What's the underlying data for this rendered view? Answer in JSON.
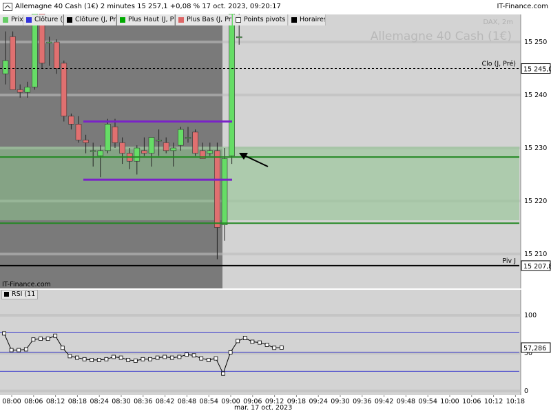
{
  "header": {
    "title": "Allemagne 40 Cash (1€) 2 minutes 15 257,1 +0,08 % 17 oct. 2023, 09:20:17",
    "brand": "IT-Finance.com"
  },
  "legend": [
    {
      "label": "Prix",
      "color": "#66cc66"
    },
    {
      "label": "Clôture (J",
      "color": "#3333dd"
    },
    {
      "label": "Clôture (J, Pré",
      "color": "#000000"
    },
    {
      "label": "Plus Haut (J, Pr",
      "color": "#00aa00"
    },
    {
      "label": "Plus Bas (J, Pr",
      "color": "#dd6666"
    },
    {
      "label": "Points pivots (",
      "color": "#ffffff"
    },
    {
      "label": "Horaires",
      "color": "#000000"
    }
  ],
  "watermark": {
    "line1": "DAX, 2m",
    "line2": "Allemagne 40 Cash (1€)"
  },
  "colors": {
    "up": "#66dd66",
    "down": "#e07070",
    "resistance": "#228822",
    "support_band": "#9cc59c",
    "range_lines": "#7a22c8",
    "pre_session": "#7a7a7a",
    "background": "#d3d3d3"
  },
  "chart_data": [
    {
      "type": "candlestick",
      "title": "Allemagne 40 Cash (1€)",
      "interval": "2 minutes",
      "x_tick_labels": [
        "08:00",
        "08:06",
        "08:12",
        "08:18",
        "08:24",
        "08:30",
        "08:36",
        "08:42",
        "08:48",
        "08:54",
        "09:00",
        "09:06",
        "09:12",
        "09:18",
        "09:24",
        "09:30",
        "09:36",
        "09:42",
        "09:48",
        "09:54",
        "10:00",
        "10:06",
        "10:12",
        "10:18"
      ],
      "date_label": "mar. 17 oct. 2023",
      "y_tick_labels": [
        "15 250",
        "15 240",
        "15 230",
        "15 220",
        "15 210"
      ],
      "ylim": [
        15203.5,
        15255.2
      ],
      "candles": [
        {
          "t": "08:00",
          "o": 15244.0,
          "h": 15252.0,
          "l": 15242.0,
          "c": 15246.5
        },
        {
          "t": "08:02",
          "o": 15251.0,
          "h": 15252.0,
          "l": 15241.0,
          "c": 15241.0
        },
        {
          "t": "08:04",
          "o": 15241.0,
          "h": 15242.0,
          "l": 15239.5,
          "c": 15240.5
        },
        {
          "t": "08:06",
          "o": 15240.5,
          "h": 15242.5,
          "l": 15239.5,
          "c": 15241.5
        },
        {
          "t": "08:08",
          "o": 15241.5,
          "h": 15256.0,
          "l": 15241.0,
          "c": 15256.0
        },
        {
          "t": "08:10",
          "o": 15256.0,
          "h": 15256.0,
          "l": 15245.0,
          "c": 15246.0
        },
        {
          "t": "08:12",
          "o": 15250.0,
          "h": 15251.0,
          "l": 15245.5,
          "c": 15250.0
        },
        {
          "t": "08:14",
          "o": 15250.0,
          "h": 15250.5,
          "l": 15244.0,
          "c": 15245.0
        },
        {
          "t": "08:16",
          "o": 15246.0,
          "h": 15246.5,
          "l": 15235.0,
          "c": 15236.0
        },
        {
          "t": "08:18",
          "o": 15236.0,
          "h": 15236.5,
          "l": 15233.5,
          "c": 15234.5
        },
        {
          "t": "08:20",
          "o": 15234.5,
          "h": 15236.0,
          "l": 15231.0,
          "c": 15231.5
        },
        {
          "t": "08:22",
          "o": 15231.5,
          "h": 15232.5,
          "l": 15229.0,
          "c": 15231.0
        },
        {
          "t": "08:24",
          "o": 15229.5,
          "h": 15231.0,
          "l": 15226.5,
          "c": 15229.5
        },
        {
          "t": "08:26",
          "o": 15228.5,
          "h": 15230.5,
          "l": 15224.5,
          "c": 15229.5
        },
        {
          "t": "08:28",
          "o": 15229.5,
          "h": 15235.5,
          "l": 15229.0,
          "c": 15234.5
        },
        {
          "t": "08:30",
          "o": 15234.0,
          "h": 15235.5,
          "l": 15230.0,
          "c": 15231.0
        },
        {
          "t": "08:32",
          "o": 15231.0,
          "h": 15232.0,
          "l": 15227.0,
          "c": 15229.0
        },
        {
          "t": "08:34",
          "o": 15229.0,
          "h": 15230.0,
          "l": 15226.0,
          "c": 15227.5
        },
        {
          "t": "08:36",
          "o": 15227.5,
          "h": 15230.5,
          "l": 15225.0,
          "c": 15230.0
        },
        {
          "t": "08:38",
          "o": 15229.5,
          "h": 15232.0,
          "l": 15228.5,
          "c": 15229.0
        },
        {
          "t": "08:40",
          "o": 15229.0,
          "h": 15231.5,
          "l": 15226.5,
          "c": 15232.0
        },
        {
          "t": "08:42",
          "o": 15231.5,
          "h": 15233.5,
          "l": 15228.5,
          "c": 15231.5
        },
        {
          "t": "08:44",
          "o": 15231.0,
          "h": 15232.0,
          "l": 15229.0,
          "c": 15229.5
        },
        {
          "t": "08:46",
          "o": 15229.5,
          "h": 15231.0,
          "l": 15226.5,
          "c": 15230.0
        },
        {
          "t": "08:48",
          "o": 15230.5,
          "h": 15234.0,
          "l": 15229.5,
          "c": 15233.5
        },
        {
          "t": "08:50",
          "o": 15232.0,
          "h": 15234.0,
          "l": 15231.0,
          "c": 15232.0
        },
        {
          "t": "08:52",
          "o": 15233.0,
          "h": 15233.5,
          "l": 15228.5,
          "c": 15229.0
        },
        {
          "t": "08:54",
          "o": 15229.5,
          "h": 15231.0,
          "l": 15228.0,
          "c": 15228.0
        },
        {
          "t": "08:56",
          "o": 15229.0,
          "h": 15231.0,
          "l": 15228.5,
          "c": 15229.5
        },
        {
          "t": "08:58",
          "o": 15229.5,
          "h": 15231.0,
          "l": 15209.0,
          "c": 15215.0
        },
        {
          "t": "09:00",
          "o": 15215.5,
          "h": 15230.0,
          "l": 15212.5,
          "c": 15228.0
        },
        {
          "t": "09:02",
          "o": 15228.5,
          "h": 15258.0,
          "l": 15227.0,
          "c": 15258.0
        },
        {
          "t": "09:04",
          "o": 15251.0,
          "h": 15257.5,
          "l": 15249.5,
          "c": 15251.0
        }
      ],
      "levels": [
        {
          "name": "Clo (J, Pré)",
          "value": "15 245,0"
        },
        {
          "name": "Piv J",
          "value": "15 207,8"
        }
      ]
    },
    {
      "type": "line",
      "title": "RSI (11",
      "y_tick_labels": [
        "100",
        "50",
        "0"
      ],
      "ylim": [
        0,
        100
      ],
      "current_value": "57,286",
      "bands": [
        26,
        51,
        77
      ],
      "x": [
        "08:00",
        "08:02",
        "08:04",
        "08:06",
        "08:08",
        "08:10",
        "08:12",
        "08:14",
        "08:16",
        "08:18",
        "08:20",
        "08:22",
        "08:24",
        "08:26",
        "08:28",
        "08:30",
        "08:32",
        "08:34",
        "08:36",
        "08:38",
        "08:40",
        "08:42",
        "08:44",
        "08:46",
        "08:48",
        "08:50",
        "08:52",
        "08:54",
        "08:56",
        "08:58",
        "09:00",
        "09:02",
        "09:04",
        "09:06",
        "09:08",
        "09:10",
        "09:12",
        "09:14",
        "09:16"
      ],
      "values": [
        76,
        54,
        54,
        55,
        68,
        69,
        69,
        73,
        57,
        46,
        44,
        42,
        41,
        41,
        42,
        45,
        44,
        41,
        40,
        42,
        42,
        44,
        45,
        44,
        45,
        48,
        47,
        43,
        41,
        43,
        23,
        51,
        66,
        70,
        65,
        64,
        61,
        57,
        57.29
      ]
    }
  ]
}
